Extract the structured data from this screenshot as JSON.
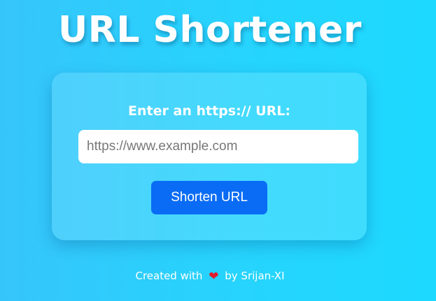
{
  "header": {
    "title": "URL Shortener"
  },
  "form": {
    "label": "Enter an https:// URL:",
    "url_input": {
      "placeholder": "https://www.example.com",
      "value": ""
    },
    "submit_label": "Shorten URL"
  },
  "footer": {
    "prefix": "Created with",
    "icon": "heart-icon",
    "heart_glyph": "❤",
    "suffix": "by Srijan-XI"
  },
  "colors": {
    "background_start": "#36c5fb",
    "background_end": "#1dd9ff",
    "button": "#0a6cf5",
    "heart": "#e21b2c",
    "text": "#ffffff"
  }
}
